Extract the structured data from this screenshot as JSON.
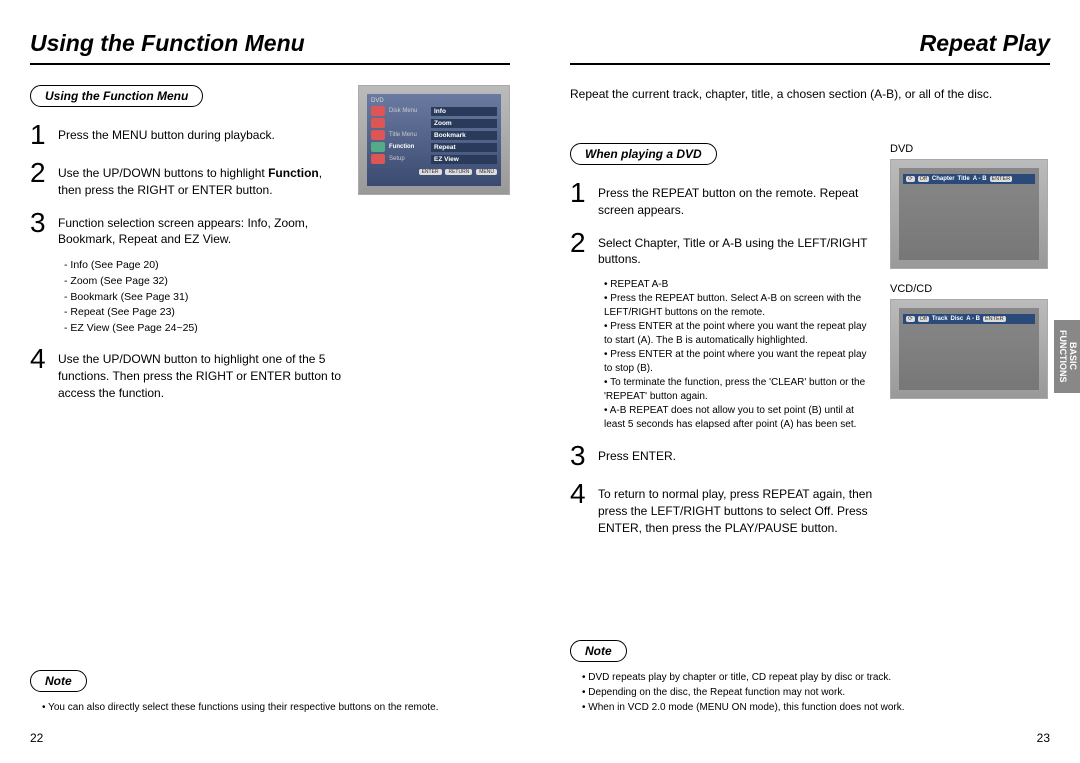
{
  "left": {
    "title": "Using the Function Menu",
    "heading": "Using the Function Menu",
    "steps": [
      "Press the MENU button during playback.",
      "Use the UP/DOWN buttons to highlight Function, then press the RIGHT or ENTER button.",
      "Function selection screen appears: Info, Zoom, Bookmark, Repeat and EZ View.",
      "Use the UP/DOWN button to highlight one of the 5 functions. Then press the RIGHT or ENTER button to access the function."
    ],
    "sublist": [
      "Info (See Page 20)",
      "Zoom (See Page 32)",
      "Bookmark (See Page 31)",
      "Repeat (See Page 23)",
      "EZ View (See Page 24~25)"
    ],
    "note_label": "Note",
    "notes": [
      "You can also directly select these functions using their respective buttons on the remote."
    ],
    "page_num": "22",
    "screen": {
      "top_label": "DVD",
      "rows": [
        {
          "label": "Disk Menu",
          "menu": "Info"
        },
        {
          "label": "",
          "menu": "Zoom"
        },
        {
          "label": "Title Menu",
          "menu": "Bookmark"
        },
        {
          "label": "Function",
          "menu": "Repeat"
        },
        {
          "label": "Setup",
          "menu": "EZ View"
        }
      ],
      "buttons": [
        "ENTER",
        "RETURN",
        "MENU"
      ]
    }
  },
  "right": {
    "title": "Repeat Play",
    "intro": "Repeat the current track, chapter, title, a chosen section (A-B), or all of the disc.",
    "heading": "When playing a DVD",
    "steps": [
      "Press the REPEAT button on the remote. Repeat screen appears.",
      "Select Chapter, Title or A-B using the LEFT/RIGHT buttons.",
      "Press ENTER.",
      "To return to normal play, press REPEAT again, then press the LEFT/RIGHT buttons to select Off. Press ENTER, then press the PLAY/PAUSE button."
    ],
    "bullets_heading": "REPEAT A-B",
    "bullets": [
      "Press the REPEAT button. Select A-B on screen with the LEFT/RIGHT buttons on the remote.",
      "Press ENTER at the point where you want the repeat play to start (A). The B is automatically highlighted.",
      "Press ENTER at the point where you want the repeat play to stop (B).",
      "To terminate the function, press the 'CLEAR' button or the 'REPEAT' button again.",
      "A-B REPEAT does not allow you to set point (B) until at least 5 seconds has elapsed after point (A) has been set."
    ],
    "note_label": "Note",
    "notes": [
      "DVD repeats play by chapter or title, CD repeat play by disc or track.",
      "Depending on the disc, the Repeat function may not work.",
      "When in VCD 2.0 mode (MENU ON mode), this function does not work."
    ],
    "page_num": "23",
    "tab1": "BASIC",
    "tab2": "FUNCTIONS",
    "tv1_label": "DVD",
    "tv1_osd": [
      "Off",
      "Chapter",
      "Title",
      "A - B",
      "ENTER"
    ],
    "tv2_label": "VCD/CD",
    "tv2_osd": [
      "Off",
      "Track",
      "Disc",
      "A - B",
      "ENTER"
    ]
  }
}
